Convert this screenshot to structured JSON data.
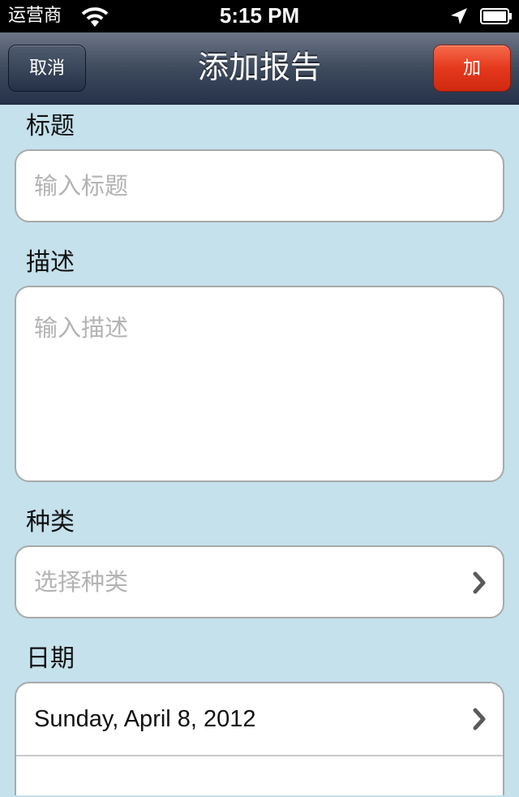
{
  "status_bar": {
    "carrier": "运营商",
    "time": "5:15 PM"
  },
  "nav": {
    "title": "添加报告",
    "cancel_label": "取消",
    "add_label": "加"
  },
  "form": {
    "title": {
      "label": "标题",
      "placeholder": "输入标题"
    },
    "description": {
      "label": "描述",
      "placeholder": "输入描述"
    },
    "category": {
      "label": "种类",
      "placeholder": "选择种类"
    },
    "date": {
      "label": "日期",
      "value": "Sunday, April 8, 2012"
    }
  },
  "colors": {
    "background": "#c4e1ec",
    "add_button": "#e5381d",
    "navbar": "#3e4a5d",
    "placeholder_text": "#b3b3b3"
  },
  "icons": [
    "wifi-icon",
    "location-arrow-icon",
    "battery-icon",
    "chevron-right-icon"
  ]
}
